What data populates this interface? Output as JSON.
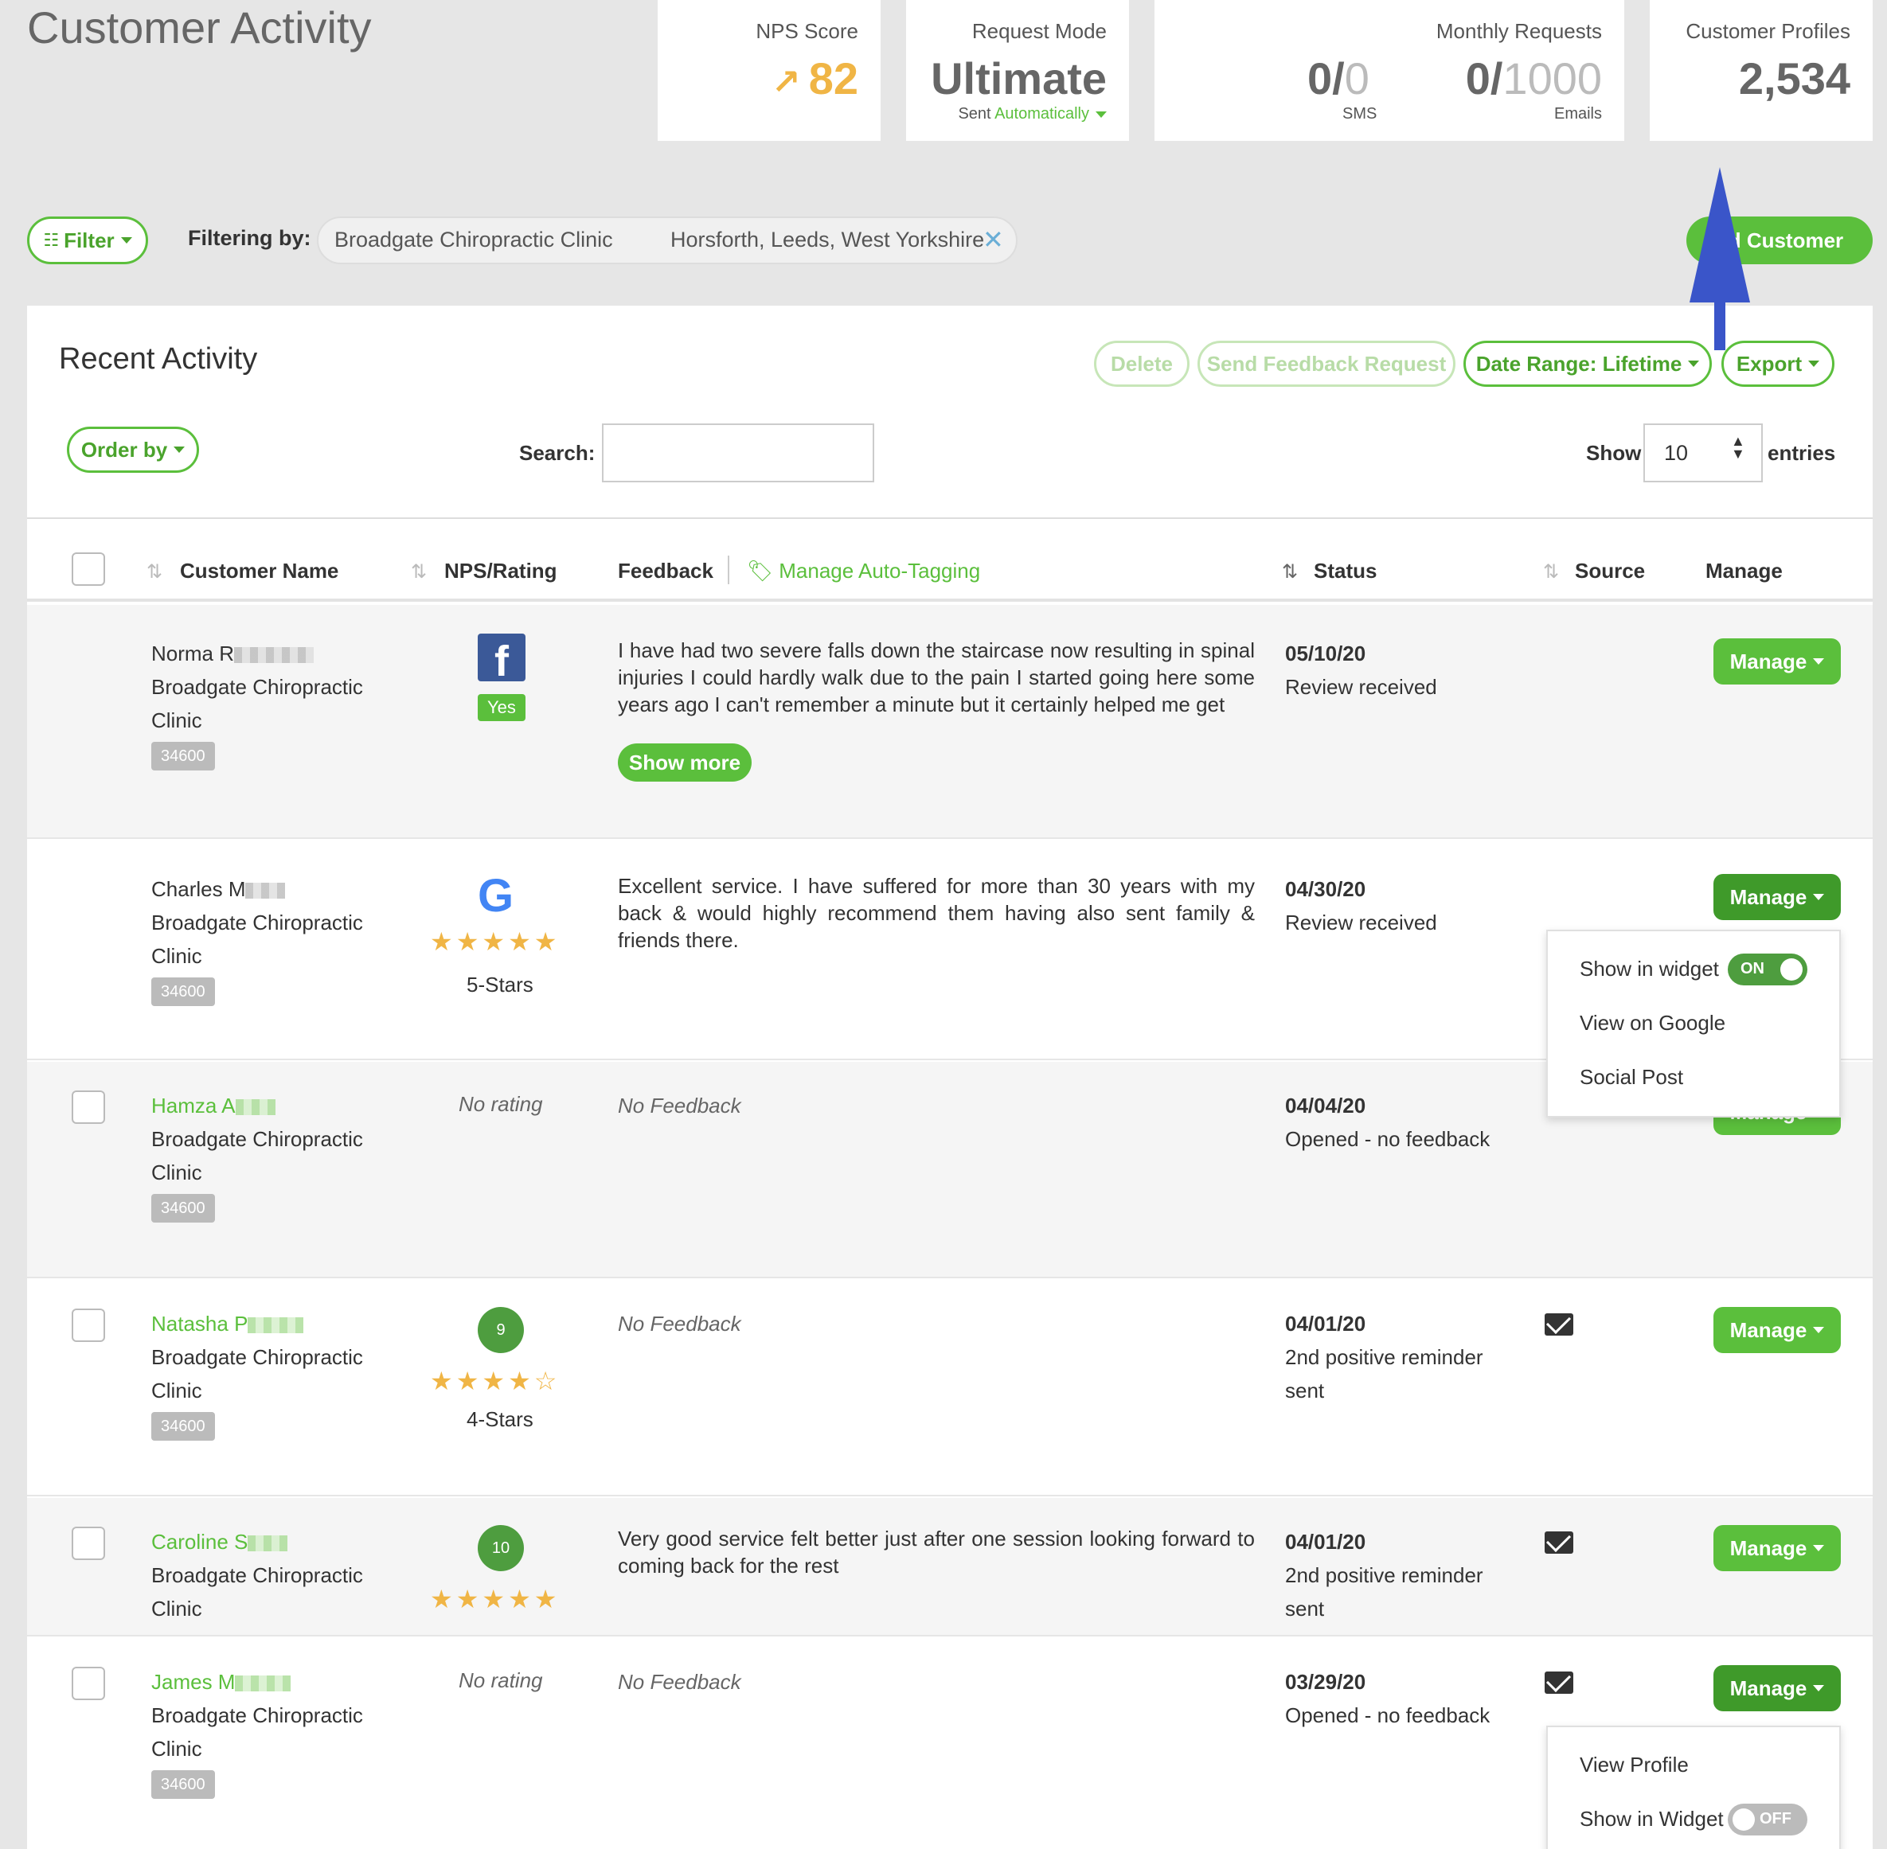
{
  "page_title": "Customer Activity",
  "stats": {
    "nps": {
      "label": "NPS Score",
      "value": "82"
    },
    "request_mode": {
      "label": "Request Mode",
      "value": "Ultimate",
      "sub_prefix": "Sent ",
      "sub_link": "Automatically"
    },
    "monthly": {
      "label": "Monthly Requests",
      "sms_used": "0/",
      "sms_total": "0",
      "sms_label": "SMS",
      "email_used": "0/",
      "email_total": "1000",
      "email_label": "Emails"
    },
    "profiles": {
      "label": "Customer Profiles",
      "value": "2,534"
    }
  },
  "filter": {
    "button": "Filter",
    "filtering_by": "Filtering by:",
    "chip_location": "Broadgate Chiropractic Clinic",
    "chip_area": "Horsforth, Leeds, West Yorkshire"
  },
  "add_customer": "dd Customer",
  "panel": {
    "title": "Recent Activity",
    "delete": "Delete",
    "send_feedback": "Send Feedback Request",
    "date_range": "Date Range: Lifetime",
    "export": "Export",
    "order_by": "Order by",
    "search_label": "Search:",
    "show_label": "Show",
    "entries_value": "10",
    "entries_label": "entries"
  },
  "columns": {
    "customer_name": "Customer Name",
    "nps_rating": "NPS/Rating",
    "feedback": "Feedback",
    "auto_tagging": "Manage Auto-Tagging",
    "status": "Status",
    "source": "Source",
    "manage": "Manage"
  },
  "rows": [
    {
      "name": "Norma R",
      "clinic1": "Broadgate Chiropractic",
      "clinic2": "Clinic",
      "tag": "34600",
      "rating_badge": "Yes",
      "feedback": "I have had two severe falls down the staircase now resulting in spinal injuries I could hardly walk due to the pain I started going here some years ago I can't remember a minute but it certainly helped me get",
      "show_more": "Show more",
      "date": "05/10/20",
      "status": "Review received",
      "manage": "Manage"
    },
    {
      "name": "Charles M",
      "clinic1": "Broadgate Chiropractic",
      "clinic2": "Clinic",
      "tag": "34600",
      "stars_label": "5-Stars",
      "feedback": "Excellent service. I have suffered for more than 30 years with my back & would highly recommend them having also sent family & friends there.",
      "date": "04/30/20",
      "status": "Review received",
      "manage": "Manage"
    },
    {
      "name": "Hamza A",
      "clinic1": "Broadgate Chiropractic",
      "clinic2": "Clinic",
      "tag": "34600",
      "rating": "No rating",
      "feedback": "No Feedback",
      "date": "04/04/20",
      "status": "Opened - no feedback",
      "manage": "Manage"
    },
    {
      "name": "Natasha P",
      "clinic1": "Broadgate Chiropractic",
      "clinic2": "Clinic",
      "tag": "34600",
      "nps": "9",
      "stars_label": "4-Stars",
      "feedback": "No Feedback",
      "date": "04/01/20",
      "status1": "2nd positive reminder",
      "status2": "sent",
      "manage": "Manage"
    },
    {
      "name": "Caroline S",
      "clinic1": "Broadgate Chiropractic",
      "clinic2": "Clinic",
      "nps": "10",
      "feedback": "Very good service felt better just after one session looking forward to coming back for the rest",
      "date": "04/01/20",
      "status1": "2nd positive reminder",
      "status2": "sent",
      "manage": "Manage"
    },
    {
      "name": "James M",
      "clinic1": "Broadgate Chiropractic",
      "clinic2": "Clinic",
      "tag": "34600",
      "rating": "No rating",
      "feedback": "No Feedback",
      "date": "03/29/20",
      "status": "Opened - no feedback",
      "manage": "Manage"
    }
  ],
  "dropdown1": {
    "show_in_widget": "Show in widget",
    "toggle": "ON",
    "view_google": "View on Google",
    "social_post": "Social Post"
  },
  "dropdown2": {
    "view_profile": "View Profile",
    "show_in_widget": "Show in Widget",
    "toggle": "OFF"
  },
  "colors": {
    "accent": "#5bbf3c",
    "dark_accent": "#3f9a2a",
    "star": "#f0b545",
    "annotation_arrow": "#3a55c9"
  }
}
